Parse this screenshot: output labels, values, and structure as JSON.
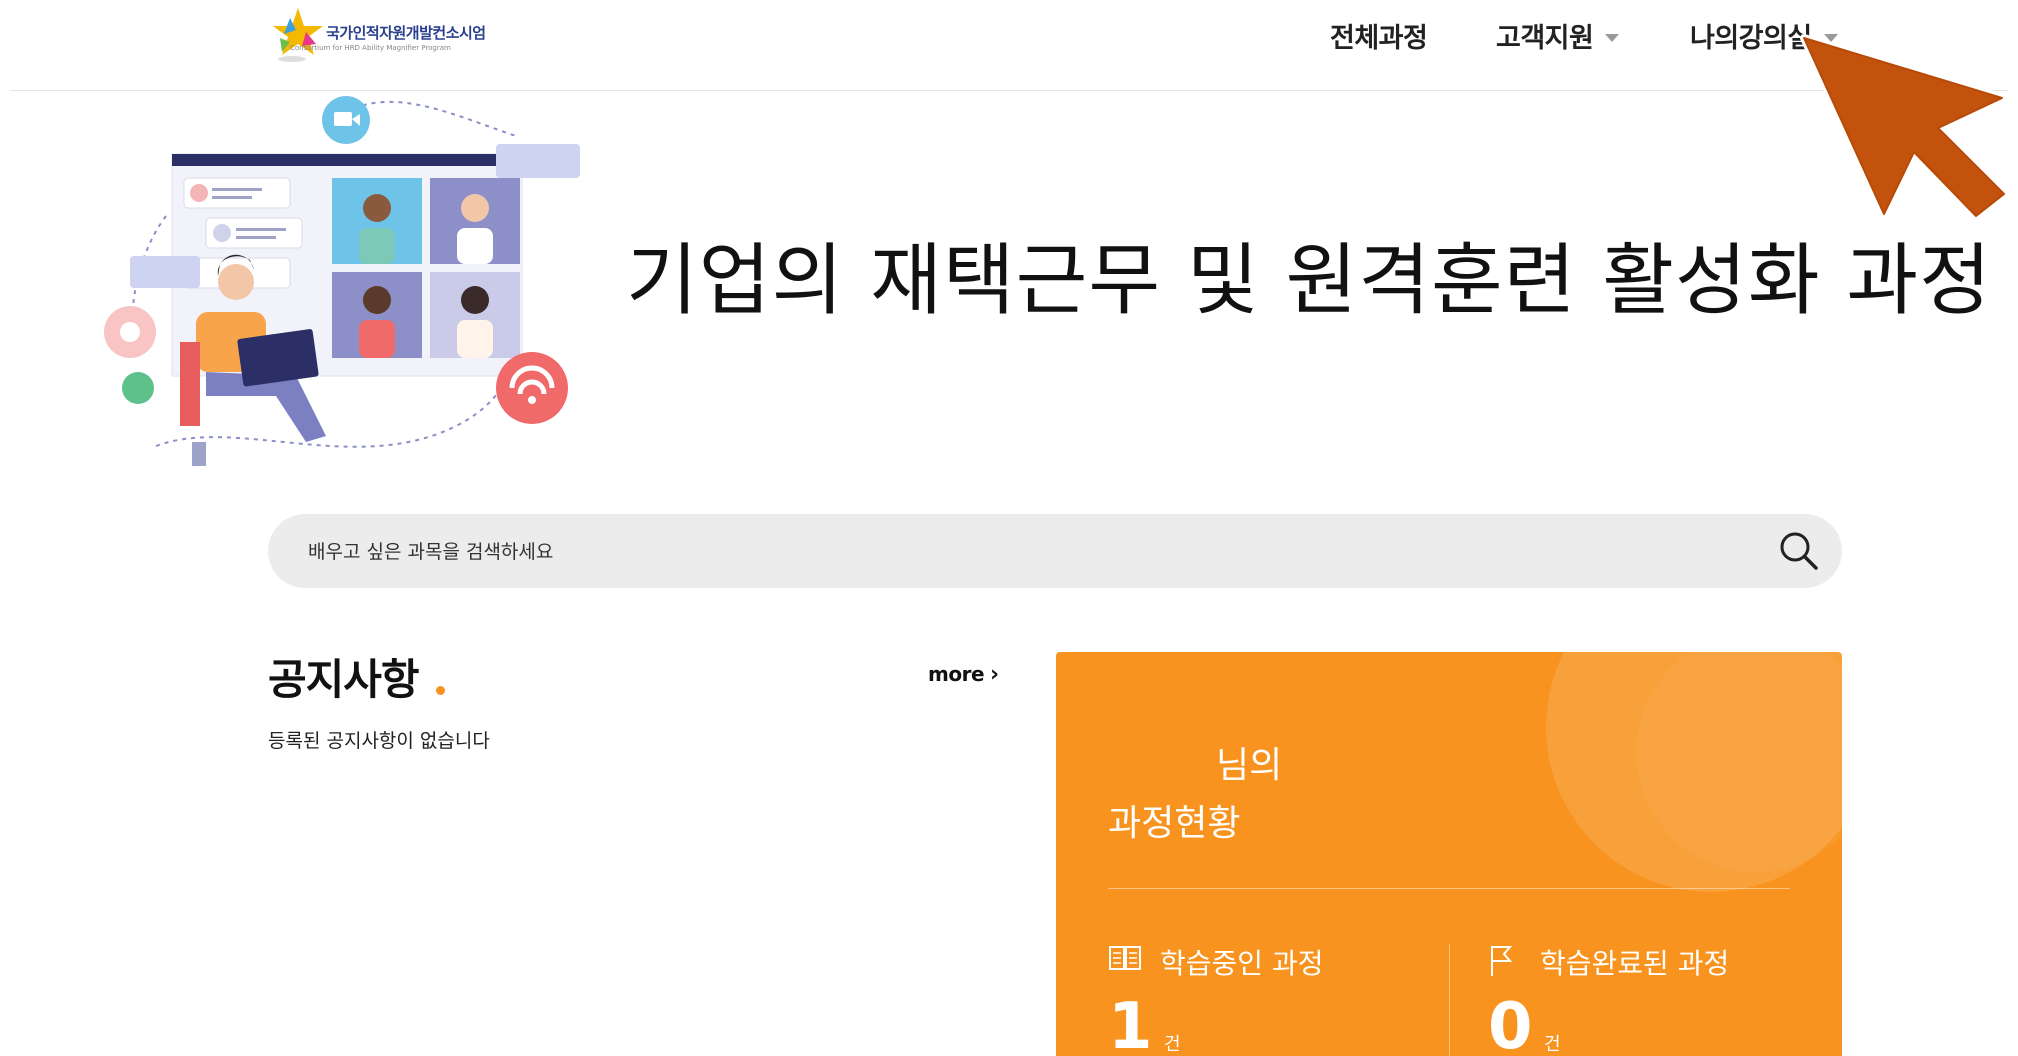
{
  "header": {
    "logo_text": "국가인적자원개발컨소시엄",
    "logo_sub": "Consortium for HRD Ability Magnifier Program",
    "nav": [
      {
        "label": "전체과정",
        "has_caret": false
      },
      {
        "label": "고객지원",
        "has_caret": true
      },
      {
        "label": "나의강의실",
        "has_caret": true
      }
    ]
  },
  "hero": {
    "title": "기업의 재택근무 및 원격훈련 활성화 과정"
  },
  "search": {
    "placeholder": "배우고 싶은 과목을 검색하세요"
  },
  "notice": {
    "title": "공지사항",
    "more_label": "more",
    "empty_message": "등록된 공지사항이 없습니다"
  },
  "status_panel": {
    "name_suffix": "님의",
    "subtitle": "과정현황",
    "in_progress_label": "학습중인 과정",
    "in_progress_count": "1",
    "completed_label": "학습완료된 과정",
    "completed_count": "0",
    "unit": "건"
  },
  "colors": {
    "accent": "#f7931e",
    "pointer": "#c2520c"
  }
}
